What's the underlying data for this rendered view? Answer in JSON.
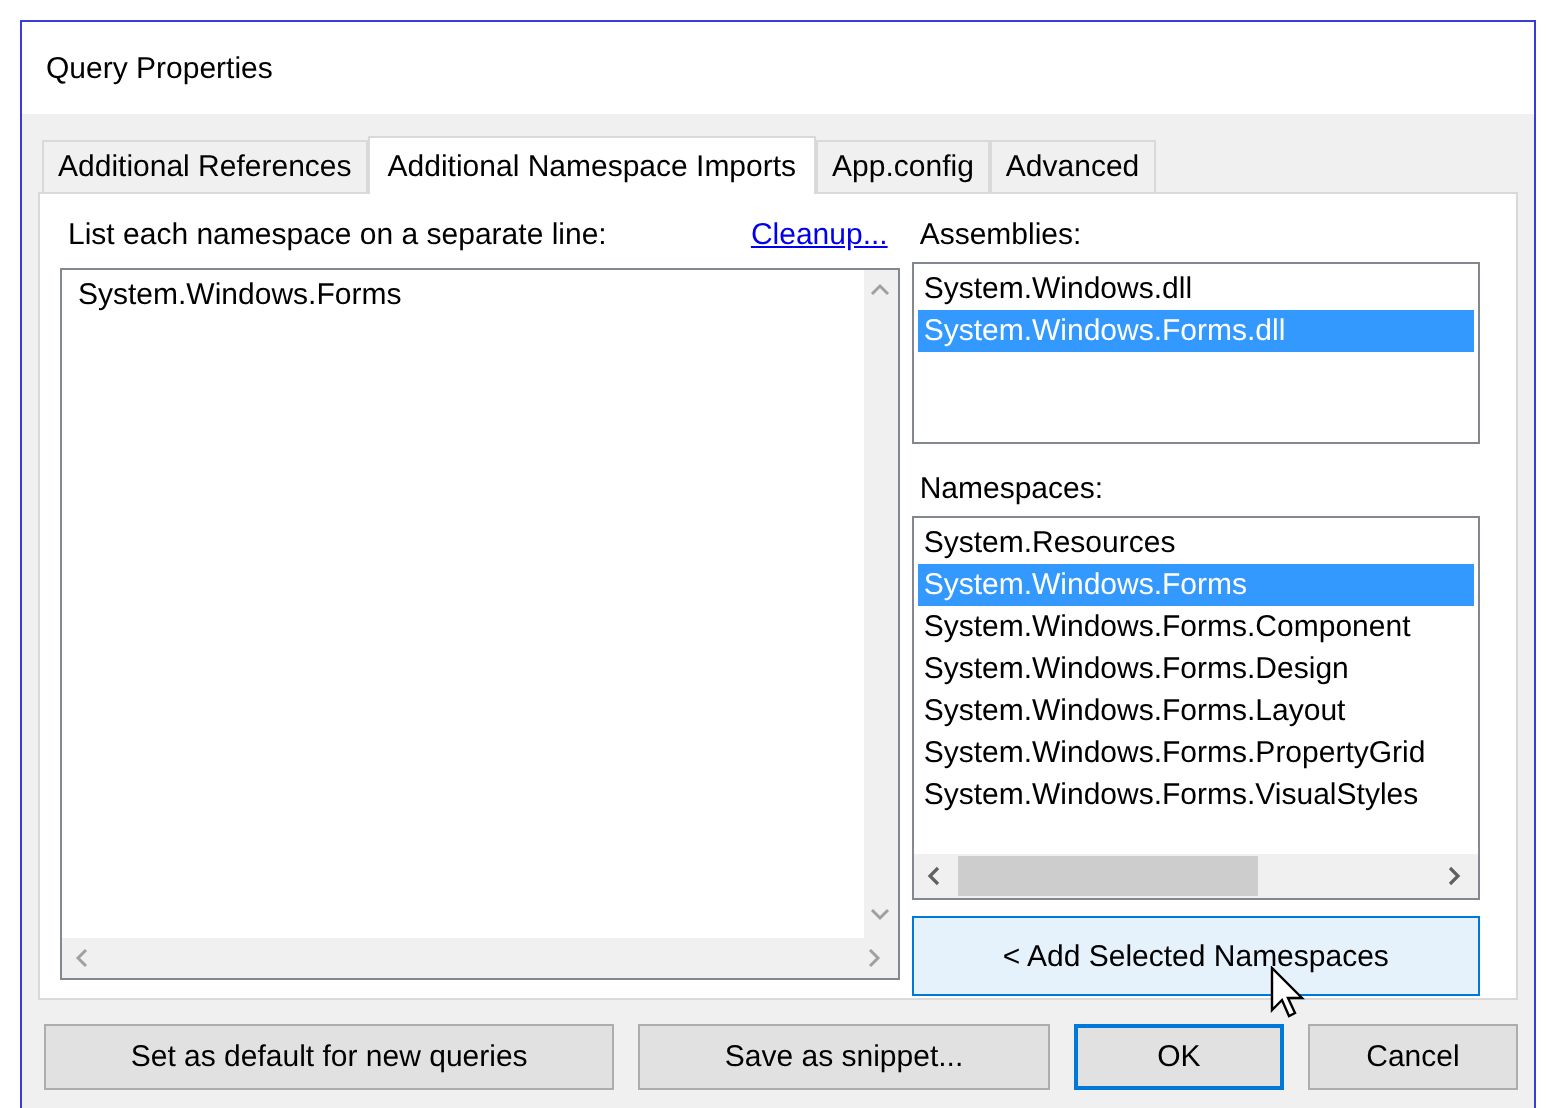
{
  "window": {
    "title": "Query Properties"
  },
  "tabs": [
    {
      "label": "Additional References",
      "selected": false
    },
    {
      "label": "Additional Namespace Imports",
      "selected": true
    },
    {
      "label": "App.config",
      "selected": false
    },
    {
      "label": "Advanced",
      "selected": false
    }
  ],
  "editor": {
    "label": "List each namespace on a separate line:",
    "link": "Cleanup...",
    "lines": [
      "System.Windows.Forms"
    ]
  },
  "assemblies": {
    "label": "Assemblies:",
    "items": [
      {
        "text": "System.Windows.dll",
        "selected": false
      },
      {
        "text": "System.Windows.Forms.dll",
        "selected": true
      }
    ]
  },
  "namespaces": {
    "label": "Namespaces:",
    "items": [
      {
        "text": "System.Resources",
        "selected": false
      },
      {
        "text": "System.Windows.Forms",
        "selected": true
      },
      {
        "text": "System.Windows.Forms.Component",
        "selected": false
      },
      {
        "text": "System.Windows.Forms.Design",
        "selected": false
      },
      {
        "text": "System.Windows.Forms.Layout",
        "selected": false
      },
      {
        "text": "System.Windows.Forms.PropertyGrid",
        "selected": false
      },
      {
        "text": "System.Windows.Forms.VisualStyles",
        "selected": false
      }
    ]
  },
  "add_button": "< Add Selected Namespaces",
  "buttons": [
    {
      "label": "Set as default for new queries",
      "kind": "normal"
    },
    {
      "label": "Save as snippet...",
      "kind": "normal"
    },
    {
      "label": "OK",
      "kind": "default"
    },
    {
      "label": "Cancel",
      "kind": "normal"
    }
  ]
}
